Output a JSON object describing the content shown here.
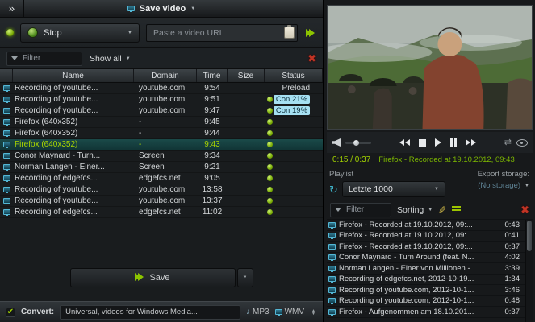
{
  "header": {
    "collapse_label": "»",
    "title": "Save video"
  },
  "capture": {
    "stop_label": "Stop",
    "url_placeholder": "Paste a video URL"
  },
  "downloads": {
    "filter_placeholder": "Filter",
    "show_all_label": "Show all",
    "columns": [
      "Name",
      "Domain",
      "Time",
      "Size",
      "Status"
    ],
    "rows": [
      {
        "name": "Recording of  youtube...",
        "domain": "youtube.com",
        "time": "9:54",
        "size": "",
        "status": "Preload",
        "dot": false,
        "badge": false,
        "selected": false
      },
      {
        "name": "Recording of  youtube...",
        "domain": "youtube.com",
        "time": "9:51",
        "size": "",
        "status": "Con 21%",
        "dot": true,
        "badge": true,
        "selected": false
      },
      {
        "name": "Recording of  youtube...",
        "domain": "youtube.com",
        "time": "9:47",
        "size": "",
        "status": "Con 19%",
        "dot": true,
        "badge": true,
        "selected": false
      },
      {
        "name": "Firefox (640x352)",
        "domain": "-",
        "time": "9:45",
        "size": "",
        "status": "",
        "dot": true,
        "badge": false,
        "selected": false
      },
      {
        "name": "Firefox (640x352)",
        "domain": "-",
        "time": "9:44",
        "size": "",
        "status": "",
        "dot": true,
        "badge": false,
        "selected": false
      },
      {
        "name": "Firefox (640x352)",
        "domain": "-",
        "time": "9:43",
        "size": "",
        "status": "",
        "dot": true,
        "badge": false,
        "selected": true
      },
      {
        "name": "Conor Maynard - Turn...",
        "domain": "Screen",
        "time": "9:34",
        "size": "",
        "status": "",
        "dot": true,
        "badge": false,
        "selected": false
      },
      {
        "name": "Norman Langen - Einer...",
        "domain": "Screen",
        "time": "9:21",
        "size": "",
        "status": "",
        "dot": true,
        "badge": false,
        "selected": false
      },
      {
        "name": "Recording of  edgefcs...",
        "domain": "edgefcs.net",
        "time": "9:05",
        "size": "",
        "status": "",
        "dot": true,
        "badge": false,
        "selected": false
      },
      {
        "name": "Recording of  youtube...",
        "domain": "youtube.com",
        "time": "13:58",
        "size": "",
        "status": "",
        "dot": true,
        "badge": false,
        "selected": false
      },
      {
        "name": "Recording of  youtube...",
        "domain": "youtube.com",
        "time": "13:37",
        "size": "",
        "status": "",
        "dot": true,
        "badge": false,
        "selected": false
      },
      {
        "name": "Recording of  edgefcs...",
        "domain": "edgefcs.net",
        "time": "11:02",
        "size": "",
        "status": "",
        "dot": true,
        "badge": false,
        "selected": false
      }
    ]
  },
  "save": {
    "label": "Save"
  },
  "convert": {
    "label": "Convert:",
    "preset": "Universal, videos for Windows Media...",
    "mp3": "MP3",
    "wmv": "WMV"
  },
  "player": {
    "time": "0:15 / 0:37",
    "now_playing": "Firefox - Recorded at 19.10.2012, 09:43"
  },
  "playlist": {
    "title": "Playlist",
    "export_label": "Export storage:",
    "export_value": "(No storage)",
    "list_name": "Letzte 1000",
    "filter_placeholder": "Filter",
    "sorting_label": "Sorting",
    "items": [
      {
        "title": "Firefox - Recorded at 19.10.2012, 09:...",
        "duration": "0:43"
      },
      {
        "title": "Firefox - Recorded at 19.10.2012, 09:...",
        "duration": "0:41"
      },
      {
        "title": "Firefox - Recorded at 19.10.2012, 09:...",
        "duration": "0:37"
      },
      {
        "title": "Conor Maynard - Turn Around (feat. N...",
        "duration": "4:02"
      },
      {
        "title": "Norman Langen - Einer von Millionen -...",
        "duration": "3:39"
      },
      {
        "title": "Recording of  edgefcs.net, 2012-10-19...",
        "duration": "1:34"
      },
      {
        "title": "Recording of  youtube.com, 2012-10-1...",
        "duration": "3:46"
      },
      {
        "title": "Recording of  youtube.com, 2012-10-1...",
        "duration": "0:48"
      },
      {
        "title": "Firefox - Aufgenommen am 18.10.201...",
        "duration": "0:37"
      }
    ]
  },
  "colors": {
    "accent": "#8dc800",
    "badge_bg": "#a6e0f2",
    "icon_blue": "#4fb3d2",
    "danger": "#c23424"
  }
}
